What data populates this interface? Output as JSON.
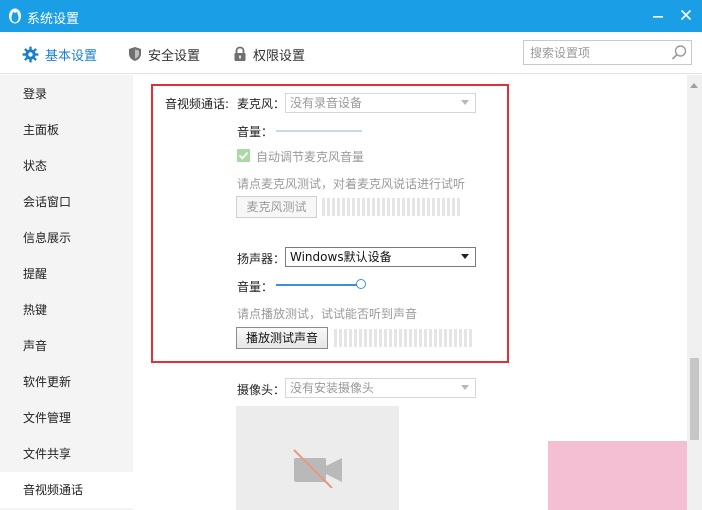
{
  "window": {
    "title": "系统设置"
  },
  "tabs": [
    {
      "label": "基本设置",
      "icon": "gear-icon",
      "active": true
    },
    {
      "label": "安全设置",
      "icon": "shield-icon",
      "active": false
    },
    {
      "label": "权限设置",
      "icon": "lock-icon",
      "active": false
    }
  ],
  "search": {
    "placeholder": "搜索设置项"
  },
  "sidebar": {
    "items": [
      {
        "label": "登录"
      },
      {
        "label": "主面板"
      },
      {
        "label": "状态"
      },
      {
        "label": "会话窗口"
      },
      {
        "label": "信息展示"
      },
      {
        "label": "提醒"
      },
      {
        "label": "热键"
      },
      {
        "label": "声音"
      },
      {
        "label": "软件更新"
      },
      {
        "label": "文件管理"
      },
      {
        "label": "文件共享"
      },
      {
        "label": "音视频通话",
        "active": true
      }
    ]
  },
  "av": {
    "section_label": "音视频通话:",
    "mic": {
      "label": "麦克风：",
      "selected": "没有录音设备",
      "volume_label": "音量：",
      "auto_adjust_label": "自动调节麦克风音量",
      "auto_adjust_checked": true,
      "hint": "请点麦克风测试，对着麦克风说话进行试听",
      "test_button": "麦克风测试"
    },
    "speaker": {
      "label": "扬声器：",
      "selected": "Windows默认设备",
      "volume_label": "音量：",
      "volume_fraction": 1.0,
      "hint": "请点播放测试，试试能否听到声音",
      "test_button": "播放测试声音"
    },
    "camera": {
      "label": "摄像头：",
      "selected": "没有安装摄像头"
    }
  },
  "colors": {
    "titlebar": "#1a9ee5",
    "accent": "#1a7fd0",
    "highlight": "#e0313a"
  }
}
